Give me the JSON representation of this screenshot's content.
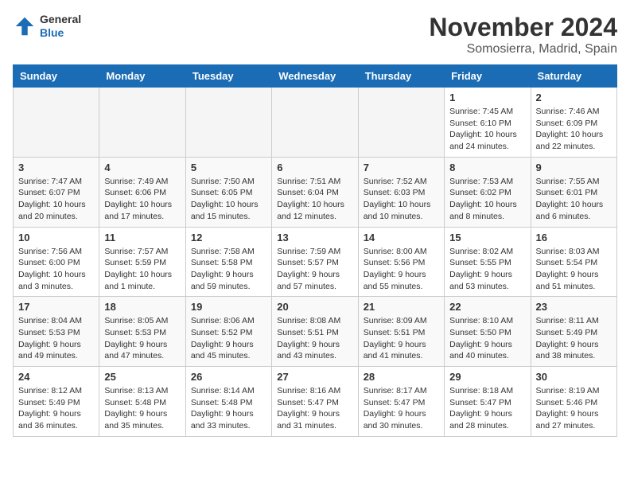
{
  "header": {
    "logo_general": "General",
    "logo_blue": "Blue",
    "month_title": "November 2024",
    "location": "Somosierra, Madrid, Spain"
  },
  "weekdays": [
    "Sunday",
    "Monday",
    "Tuesday",
    "Wednesday",
    "Thursday",
    "Friday",
    "Saturday"
  ],
  "weeks": [
    [
      {
        "day": "",
        "info": ""
      },
      {
        "day": "",
        "info": ""
      },
      {
        "day": "",
        "info": ""
      },
      {
        "day": "",
        "info": ""
      },
      {
        "day": "",
        "info": ""
      },
      {
        "day": "1",
        "info": "Sunrise: 7:45 AM\nSunset: 6:10 PM\nDaylight: 10 hours and 24 minutes."
      },
      {
        "day": "2",
        "info": "Sunrise: 7:46 AM\nSunset: 6:09 PM\nDaylight: 10 hours and 22 minutes."
      }
    ],
    [
      {
        "day": "3",
        "info": "Sunrise: 7:47 AM\nSunset: 6:07 PM\nDaylight: 10 hours and 20 minutes."
      },
      {
        "day": "4",
        "info": "Sunrise: 7:49 AM\nSunset: 6:06 PM\nDaylight: 10 hours and 17 minutes."
      },
      {
        "day": "5",
        "info": "Sunrise: 7:50 AM\nSunset: 6:05 PM\nDaylight: 10 hours and 15 minutes."
      },
      {
        "day": "6",
        "info": "Sunrise: 7:51 AM\nSunset: 6:04 PM\nDaylight: 10 hours and 12 minutes."
      },
      {
        "day": "7",
        "info": "Sunrise: 7:52 AM\nSunset: 6:03 PM\nDaylight: 10 hours and 10 minutes."
      },
      {
        "day": "8",
        "info": "Sunrise: 7:53 AM\nSunset: 6:02 PM\nDaylight: 10 hours and 8 minutes."
      },
      {
        "day": "9",
        "info": "Sunrise: 7:55 AM\nSunset: 6:01 PM\nDaylight: 10 hours and 6 minutes."
      }
    ],
    [
      {
        "day": "10",
        "info": "Sunrise: 7:56 AM\nSunset: 6:00 PM\nDaylight: 10 hours and 3 minutes."
      },
      {
        "day": "11",
        "info": "Sunrise: 7:57 AM\nSunset: 5:59 PM\nDaylight: 10 hours and 1 minute."
      },
      {
        "day": "12",
        "info": "Sunrise: 7:58 AM\nSunset: 5:58 PM\nDaylight: 9 hours and 59 minutes."
      },
      {
        "day": "13",
        "info": "Sunrise: 7:59 AM\nSunset: 5:57 PM\nDaylight: 9 hours and 57 minutes."
      },
      {
        "day": "14",
        "info": "Sunrise: 8:00 AM\nSunset: 5:56 PM\nDaylight: 9 hours and 55 minutes."
      },
      {
        "day": "15",
        "info": "Sunrise: 8:02 AM\nSunset: 5:55 PM\nDaylight: 9 hours and 53 minutes."
      },
      {
        "day": "16",
        "info": "Sunrise: 8:03 AM\nSunset: 5:54 PM\nDaylight: 9 hours and 51 minutes."
      }
    ],
    [
      {
        "day": "17",
        "info": "Sunrise: 8:04 AM\nSunset: 5:53 PM\nDaylight: 9 hours and 49 minutes."
      },
      {
        "day": "18",
        "info": "Sunrise: 8:05 AM\nSunset: 5:53 PM\nDaylight: 9 hours and 47 minutes."
      },
      {
        "day": "19",
        "info": "Sunrise: 8:06 AM\nSunset: 5:52 PM\nDaylight: 9 hours and 45 minutes."
      },
      {
        "day": "20",
        "info": "Sunrise: 8:08 AM\nSunset: 5:51 PM\nDaylight: 9 hours and 43 minutes."
      },
      {
        "day": "21",
        "info": "Sunrise: 8:09 AM\nSunset: 5:51 PM\nDaylight: 9 hours and 41 minutes."
      },
      {
        "day": "22",
        "info": "Sunrise: 8:10 AM\nSunset: 5:50 PM\nDaylight: 9 hours and 40 minutes."
      },
      {
        "day": "23",
        "info": "Sunrise: 8:11 AM\nSunset: 5:49 PM\nDaylight: 9 hours and 38 minutes."
      }
    ],
    [
      {
        "day": "24",
        "info": "Sunrise: 8:12 AM\nSunset: 5:49 PM\nDaylight: 9 hours and 36 minutes."
      },
      {
        "day": "25",
        "info": "Sunrise: 8:13 AM\nSunset: 5:48 PM\nDaylight: 9 hours and 35 minutes."
      },
      {
        "day": "26",
        "info": "Sunrise: 8:14 AM\nSunset: 5:48 PM\nDaylight: 9 hours and 33 minutes."
      },
      {
        "day": "27",
        "info": "Sunrise: 8:16 AM\nSunset: 5:47 PM\nDaylight: 9 hours and 31 minutes."
      },
      {
        "day": "28",
        "info": "Sunrise: 8:17 AM\nSunset: 5:47 PM\nDaylight: 9 hours and 30 minutes."
      },
      {
        "day": "29",
        "info": "Sunrise: 8:18 AM\nSunset: 5:47 PM\nDaylight: 9 hours and 28 minutes."
      },
      {
        "day": "30",
        "info": "Sunrise: 8:19 AM\nSunset: 5:46 PM\nDaylight: 9 hours and 27 minutes."
      }
    ]
  ]
}
